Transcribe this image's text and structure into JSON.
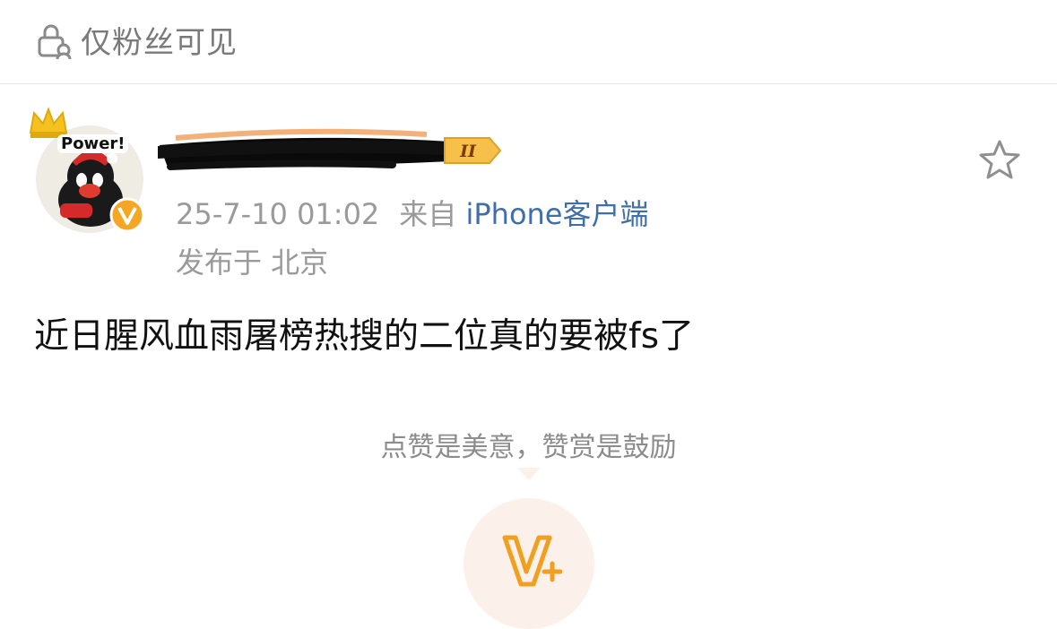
{
  "visibility": {
    "icon": "lock-people-icon",
    "label": "仅粉丝可见"
  },
  "author": {
    "avatar_badge": "Power!",
    "verified_icon": "verified-v-icon",
    "level_label": "II"
  },
  "post_meta": {
    "time": "25-7-10 01:02",
    "from_label": "来自",
    "source": "iPhone客户端",
    "location_label": "发布于 北京"
  },
  "actions": {
    "favorite_icon": "star-icon"
  },
  "post": {
    "text": "近日腥风血雨屠榜热搜的二位真的要被fs了"
  },
  "reward": {
    "text": "点赞是美意，赞赏是鼓励",
    "icon": "reward-v-plus-icon"
  },
  "colors": {
    "accent": "#f0a020",
    "link": "#3f6ea8",
    "muted": "#9a9a9a"
  }
}
